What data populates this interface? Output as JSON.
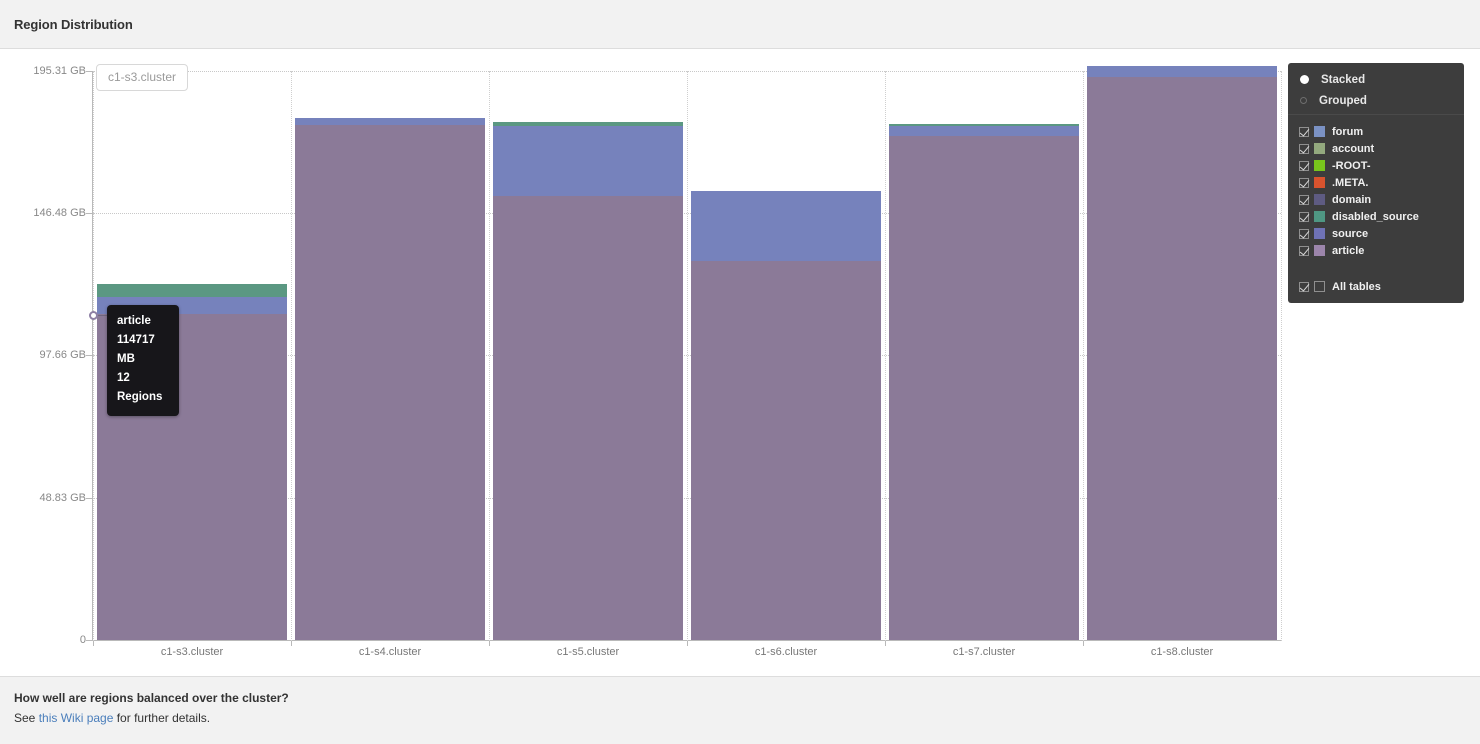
{
  "header": {
    "title": "Region Distribution"
  },
  "footer": {
    "question": "How well are regions balanced over the cluster?",
    "see_prefix": "See ",
    "link_text": "this Wiki page",
    "see_suffix": " for further details."
  },
  "hover_label": {
    "text": "c1-s3.cluster"
  },
  "tooltip": {
    "title": "article",
    "size": "114717 MB",
    "regions": "12 Regions"
  },
  "legend": {
    "modes": [
      {
        "label": "Stacked",
        "selected": true
      },
      {
        "label": "Grouped",
        "selected": false
      }
    ],
    "items": [
      {
        "label": "forum",
        "color": "#7b92c4",
        "checked": true
      },
      {
        "label": "account",
        "color": "#93a97e",
        "checked": true
      },
      {
        "label": "-ROOT-",
        "color": "#78c51c",
        "checked": true
      },
      {
        "label": ".META.",
        "color": "#d8532e",
        "checked": true
      },
      {
        "label": "domain",
        "color": "#5e5b82",
        "checked": true
      },
      {
        "label": "disabled_source",
        "color": "#4f9783",
        "checked": true
      },
      {
        "label": "source",
        "color": "#6f72b5",
        "checked": true
      },
      {
        "label": "article",
        "color": "#9c85ab",
        "checked": true
      }
    ],
    "all_tables": {
      "label": "All tables",
      "checked": true
    }
  },
  "chart_data": {
    "type": "bar",
    "mode": "stacked",
    "title": "Region Distribution",
    "xlabel": "",
    "ylabel": "",
    "unit": "GB",
    "grid": true,
    "legend_position": "right",
    "ylim": [
      0,
      195.31
    ],
    "ytick_labels": [
      "195.31 GB",
      "146.48 GB",
      "97.66 GB",
      "48.83 GB",
      "0"
    ],
    "ytick_values": [
      195.31,
      146.48,
      97.66,
      48.83,
      0
    ],
    "categories": [
      "c1-s3.cluster",
      "c1-s4.cluster",
      "c1-s5.cluster",
      "c1-s6.cluster",
      "c1-s7.cluster",
      "c1-s8.cluster"
    ],
    "series": [
      {
        "name": "article",
        "color": "#8b7a98",
        "values": [
          112.03,
          176.7,
          152.53,
          130.0,
          172.95,
          193.26
        ]
      },
      {
        "name": "source",
        "color": "#7682bc",
        "values": [
          5.83,
          2.4,
          23.78,
          24.0,
          3.43,
          3.77
        ]
      },
      {
        "name": "disabled_source",
        "color": "#5b9882",
        "values": [
          4.46,
          0.0,
          1.37,
          0.0,
          0.69,
          0.0
        ]
      },
      {
        "name": "domain",
        "color": "#5e5b82",
        "values": [
          0.0,
          0.0,
          0.0,
          0.0,
          0.0,
          0.0
        ]
      },
      {
        "name": ".META.",
        "color": "#d8532e",
        "values": [
          0.0,
          0.0,
          0.0,
          0.0,
          0.0,
          0.0
        ]
      },
      {
        "name": "-ROOT-",
        "color": "#78c51c",
        "values": [
          0.0,
          0.0,
          0.0,
          0.0,
          0.0,
          0.0
        ]
      },
      {
        "name": "account",
        "color": "#93a97e",
        "values": [
          0.0,
          0.0,
          0.0,
          0.0,
          0.0,
          0.0
        ]
      },
      {
        "name": "forum",
        "color": "#7b92c4",
        "values": [
          0.0,
          0.0,
          0.0,
          0.0,
          0.0,
          0.0
        ]
      }
    ],
    "totals": [
      122.32,
      179.1,
      177.68,
      154.0,
      177.07,
      197.03
    ],
    "hovered": {
      "category": "c1-s3.cluster",
      "series": "article",
      "size_mb": 114717,
      "regions": 12
    }
  }
}
